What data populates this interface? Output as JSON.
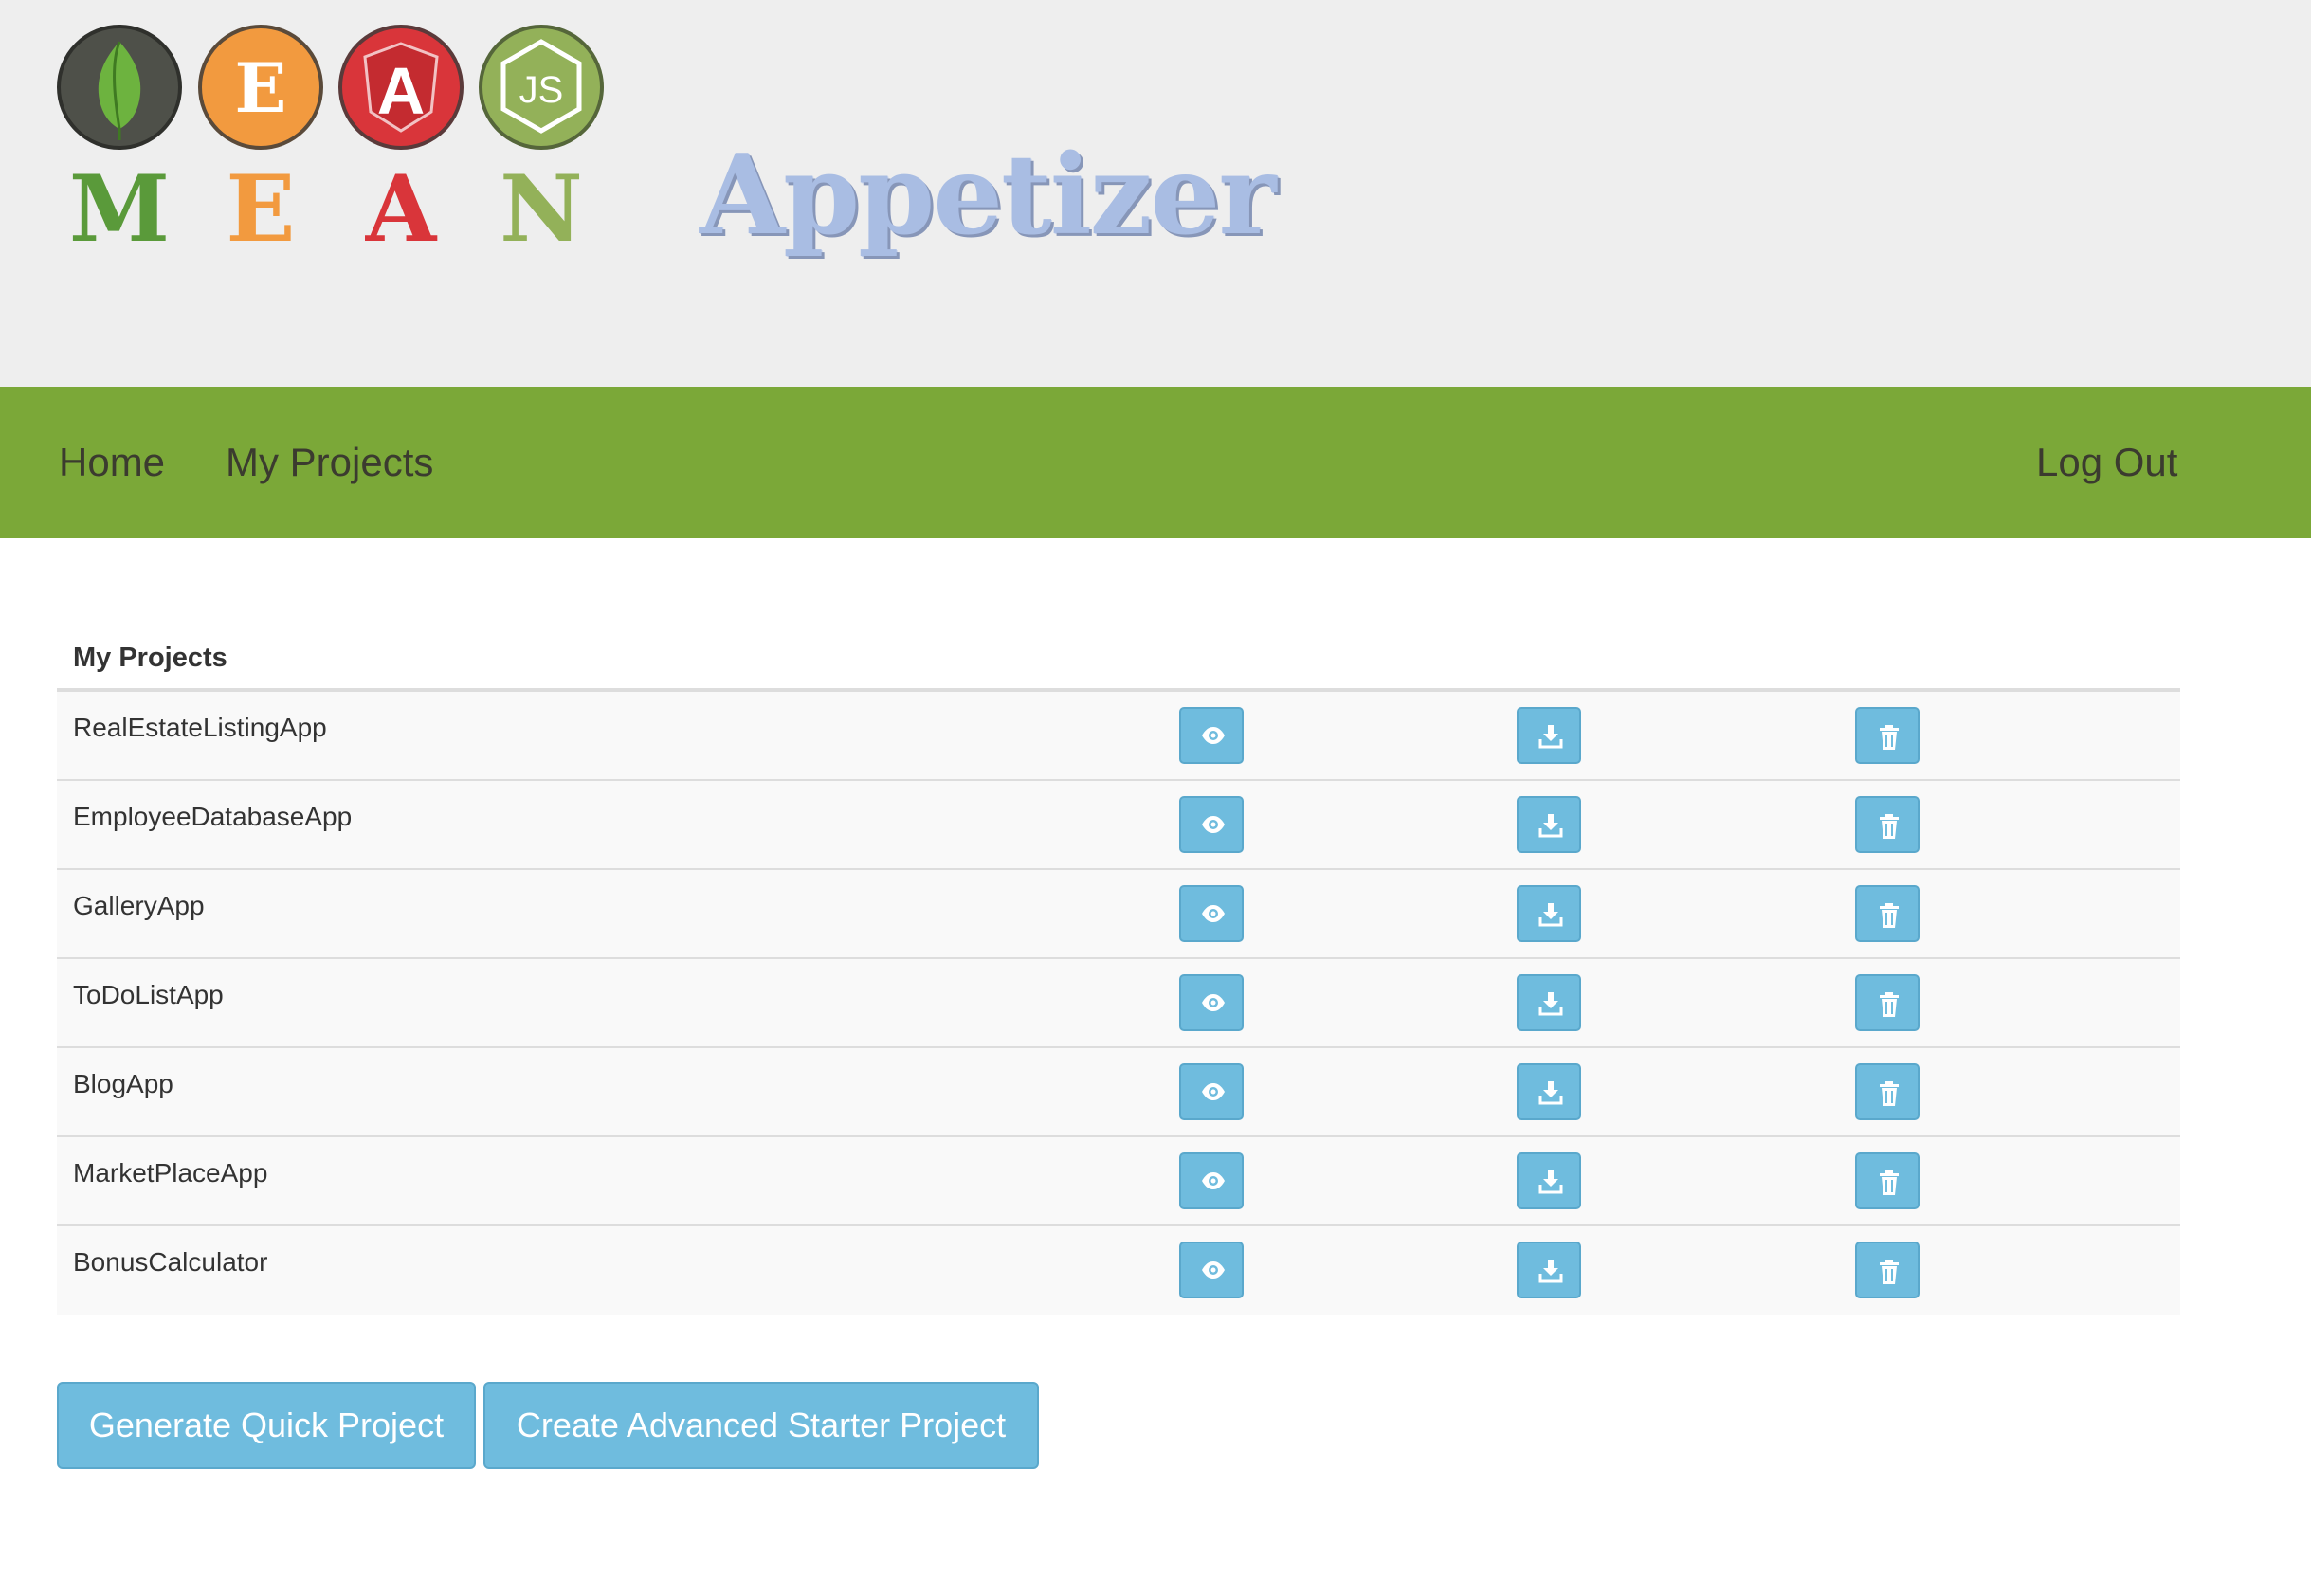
{
  "header": {
    "logo_letters": [
      "M",
      "E",
      "A",
      "N"
    ],
    "logo_icons": [
      "mongodb-leaf-icon",
      "express-e-icon",
      "angular-shield-icon",
      "nodejs-hexagon-icon"
    ],
    "logo_marks": {
      "express": "E",
      "angular": "A",
      "node": "JS"
    },
    "app_title": "Appetizer"
  },
  "navbar": {
    "home": "Home",
    "my_projects": "My Projects",
    "log_out": "Log Out",
    "background_color": "#7ba838"
  },
  "table": {
    "header": "My Projects",
    "rows": [
      {
        "name": "RealEstateListingApp"
      },
      {
        "name": "EmployeeDatabaseApp"
      },
      {
        "name": "GalleryApp"
      },
      {
        "name": "ToDoListApp"
      },
      {
        "name": "BlogApp"
      },
      {
        "name": "MarketPlaceApp"
      },
      {
        "name": "BonusCalculator"
      }
    ],
    "row_actions": [
      "eye-icon",
      "download-icon",
      "trash-icon"
    ],
    "button_color": "#6fbcde"
  },
  "actions": {
    "generate_quick": "Generate Quick Project",
    "create_advanced": "Create Advanced Starter Project"
  }
}
